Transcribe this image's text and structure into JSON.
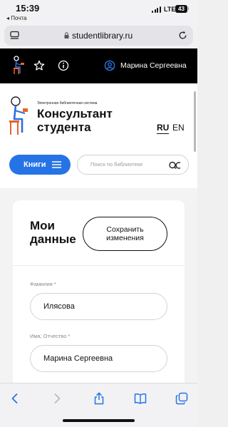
{
  "status": {
    "time": "15:39",
    "back_label": "◂ Почта",
    "network": "LTE",
    "battery": "43"
  },
  "browser": {
    "url": "studentlibrary.ru"
  },
  "topnav": {
    "user_name": "Марина Сергеевна"
  },
  "brand": {
    "caption": "Электронная библиотечная система",
    "title_line1": "Консультант",
    "title_line2": "студента"
  },
  "lang": {
    "ru": "RU",
    "en": "EN"
  },
  "books_button": "Книги",
  "search": {
    "placeholder": "Поиск по библиотеке"
  },
  "profile": {
    "title_line1": "Мои",
    "title_line2": "данные",
    "save_line1": "Сохранить",
    "save_line2": "изменения",
    "fields": [
      {
        "label": "Фамилия *",
        "value": "Илясова"
      },
      {
        "label": "Имя, Отчество *",
        "value": "Марина Сергеевна"
      }
    ]
  },
  "colors": {
    "accent": "#2673e6",
    "nav_bg": "#000000",
    "figure_orange": "#e8632b"
  },
  "icons": [
    "menu-icon",
    "lock-icon",
    "reload-icon",
    "reader-figure-icon",
    "star-icon",
    "info-icon",
    "user-icon",
    "hamburger-icon",
    "search-icon",
    "back-icon",
    "forward-icon",
    "share-icon",
    "bookmarks-icon",
    "tabs-icon"
  ]
}
